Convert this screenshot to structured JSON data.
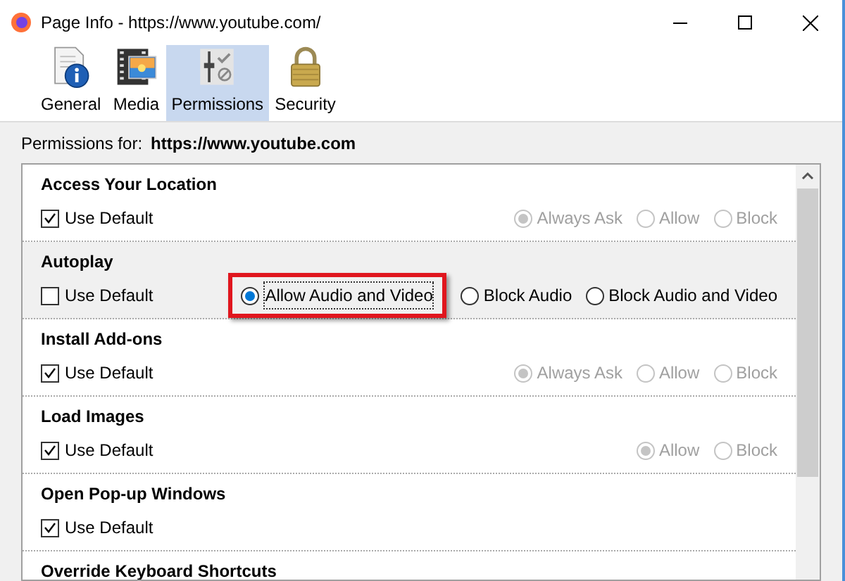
{
  "window": {
    "title": "Page Info - https://www.youtube.com/"
  },
  "tabs": [
    {
      "label": "General",
      "selected": false
    },
    {
      "label": "Media",
      "selected": false
    },
    {
      "label": "Permissions",
      "selected": true
    },
    {
      "label": "Security",
      "selected": false
    }
  ],
  "permissions_for": {
    "label": "Permissions for:",
    "site": "https://www.youtube.com"
  },
  "permissions": [
    {
      "name": "Access Your Location",
      "use_default": {
        "label": "Use Default",
        "checked": true
      },
      "options": [
        {
          "label": "Always Ask",
          "selected": true
        },
        {
          "label": "Allow",
          "selected": false
        },
        {
          "label": "Block",
          "selected": false
        }
      ]
    },
    {
      "name": "Autoplay",
      "use_default": {
        "label": "Use Default",
        "checked": false
      },
      "options": [
        {
          "label": "Allow Audio and Video",
          "selected": true,
          "highlighted": true
        },
        {
          "label": "Block Audio",
          "selected": false,
          "highlighted": false
        },
        {
          "label": "Block Audio and Video",
          "selected": false,
          "highlighted": false
        }
      ]
    },
    {
      "name": "Install Add-ons",
      "use_default": {
        "label": "Use Default",
        "checked": true
      },
      "options": [
        {
          "label": "Always Ask",
          "selected": true
        },
        {
          "label": "Allow",
          "selected": false
        },
        {
          "label": "Block",
          "selected": false
        }
      ]
    },
    {
      "name": "Load Images",
      "use_default": {
        "label": "Use Default",
        "checked": true
      },
      "options": [
        {
          "label": "Allow",
          "selected": true
        },
        {
          "label": "Block",
          "selected": false
        }
      ]
    },
    {
      "name": "Open Pop-up Windows",
      "use_default": {
        "label": "Use Default",
        "checked": true
      }
    },
    {
      "name": "Override Keyboard Shortcuts"
    }
  ]
}
